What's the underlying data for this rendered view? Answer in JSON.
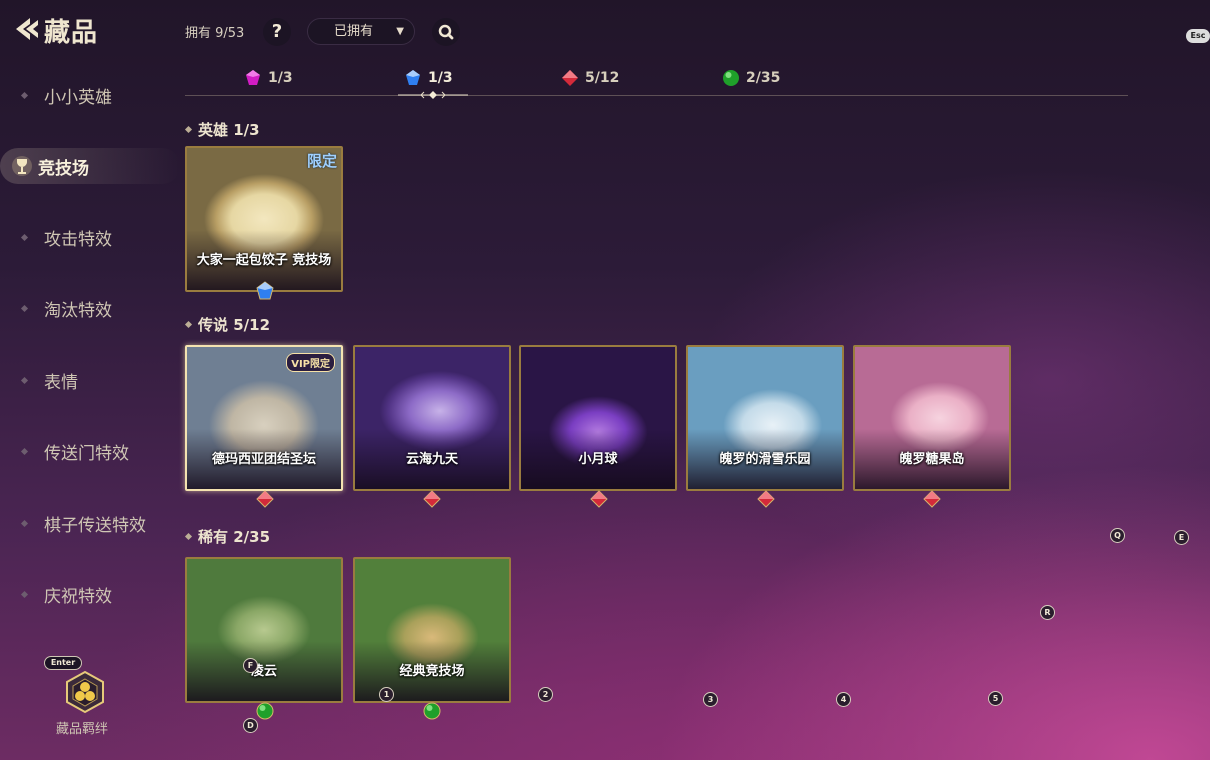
{
  "header": {
    "title": "藏品",
    "owned_count": "拥有 9/53",
    "help_label": "?",
    "filter_value": "已拥有",
    "esc_hint": "Esc"
  },
  "rarity_tabs": [
    {
      "count": "1/3",
      "gem_color": "#d21cc4"
    },
    {
      "count": "1/3",
      "gem_color": "#2f7ff0"
    },
    {
      "count": "5/12",
      "gem_color": "#d42a3a"
    },
    {
      "count": "2/35",
      "gem_color": "#1fa02a"
    }
  ],
  "sidebar": {
    "items": [
      {
        "label": "小小英雄"
      },
      {
        "label": "竞技场"
      },
      {
        "label": "攻击特效"
      },
      {
        "label": "淘汰特效"
      },
      {
        "label": "表情"
      },
      {
        "label": "传送门特效"
      },
      {
        "label": "棋子传送特效"
      },
      {
        "label": "庆祝特效"
      }
    ],
    "active_index": 1,
    "enter_hint": "Enter",
    "bond_label": "藏品羁绊"
  },
  "sections": {
    "hero": {
      "title": "英雄 1/3"
    },
    "legend": {
      "title": "传说 5/12"
    },
    "rare": {
      "title": "稀有 2/35"
    }
  },
  "cards": {
    "hero": [
      {
        "name": "大家一起包饺子 竞技场",
        "tag": "限定"
      }
    ],
    "legend": [
      {
        "name": "德玛西亚团结圣坛",
        "tag": "VIP限定"
      },
      {
        "name": "云海九天"
      },
      {
        "name": "小月球"
      },
      {
        "name": "魄罗的滑雪乐园"
      },
      {
        "name": "魄罗糖果岛"
      }
    ],
    "rare": [
      {
        "name": "凌云"
      },
      {
        "name": "经典竞技场"
      }
    ]
  },
  "key_hints": {
    "f": "F",
    "d": "D",
    "one": "1",
    "two": "2",
    "three": "3",
    "four": "4",
    "five": "5",
    "q": "Q",
    "e": "E",
    "r": "R"
  },
  "colors": {
    "gem_hero": "#2f7ff0",
    "gem_legend": "#d42a3a",
    "gem_rare": "#1fa02a",
    "card_border": "#9a7c3f",
    "selected_border": "#f4e3b0"
  },
  "icons": [
    "back-arrow-icon",
    "help-icon",
    "chevron-down-icon",
    "search-icon",
    "trophy-icon",
    "honeycomb-icon",
    "gem-icon"
  ]
}
